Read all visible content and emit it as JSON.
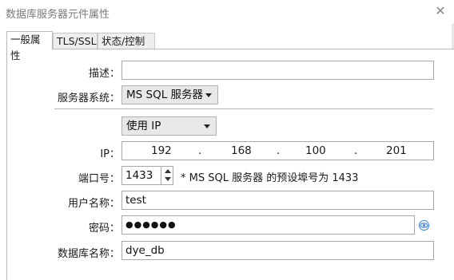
{
  "window": {
    "title": "数据库服务器元件属性",
    "close_glyph": "✕"
  },
  "tabs": [
    {
      "label": "一般属性",
      "active": true
    },
    {
      "label": "TLS/SSL",
      "active": false
    },
    {
      "label": "状态/控制",
      "active": false
    }
  ],
  "form": {
    "description_label": "描述：",
    "description_value": "",
    "server_system_label": "服务器系统：",
    "server_system_value": "MS SQL 服务器",
    "connection_mode_value": "使用 IP",
    "ip_label": "IP：",
    "ip_octets": [
      "192",
      "168",
      "100",
      "201"
    ],
    "ip_separator": ".",
    "port_label": "端口号：",
    "port_value": "1433",
    "port_hint": "* MS SQL 服务器 的预设埠号为 1433",
    "username_label": "用户名称：",
    "username_value": "test",
    "password_label": "密码：",
    "password_value": "●●●●●●",
    "dbname_label": "数据库名称：",
    "dbname_value": "dye_db"
  },
  "colors": {
    "accent_eye": "#3b7fd8",
    "tab_active_bg": "#ffffff",
    "select_bg": "#e8e8e8"
  }
}
